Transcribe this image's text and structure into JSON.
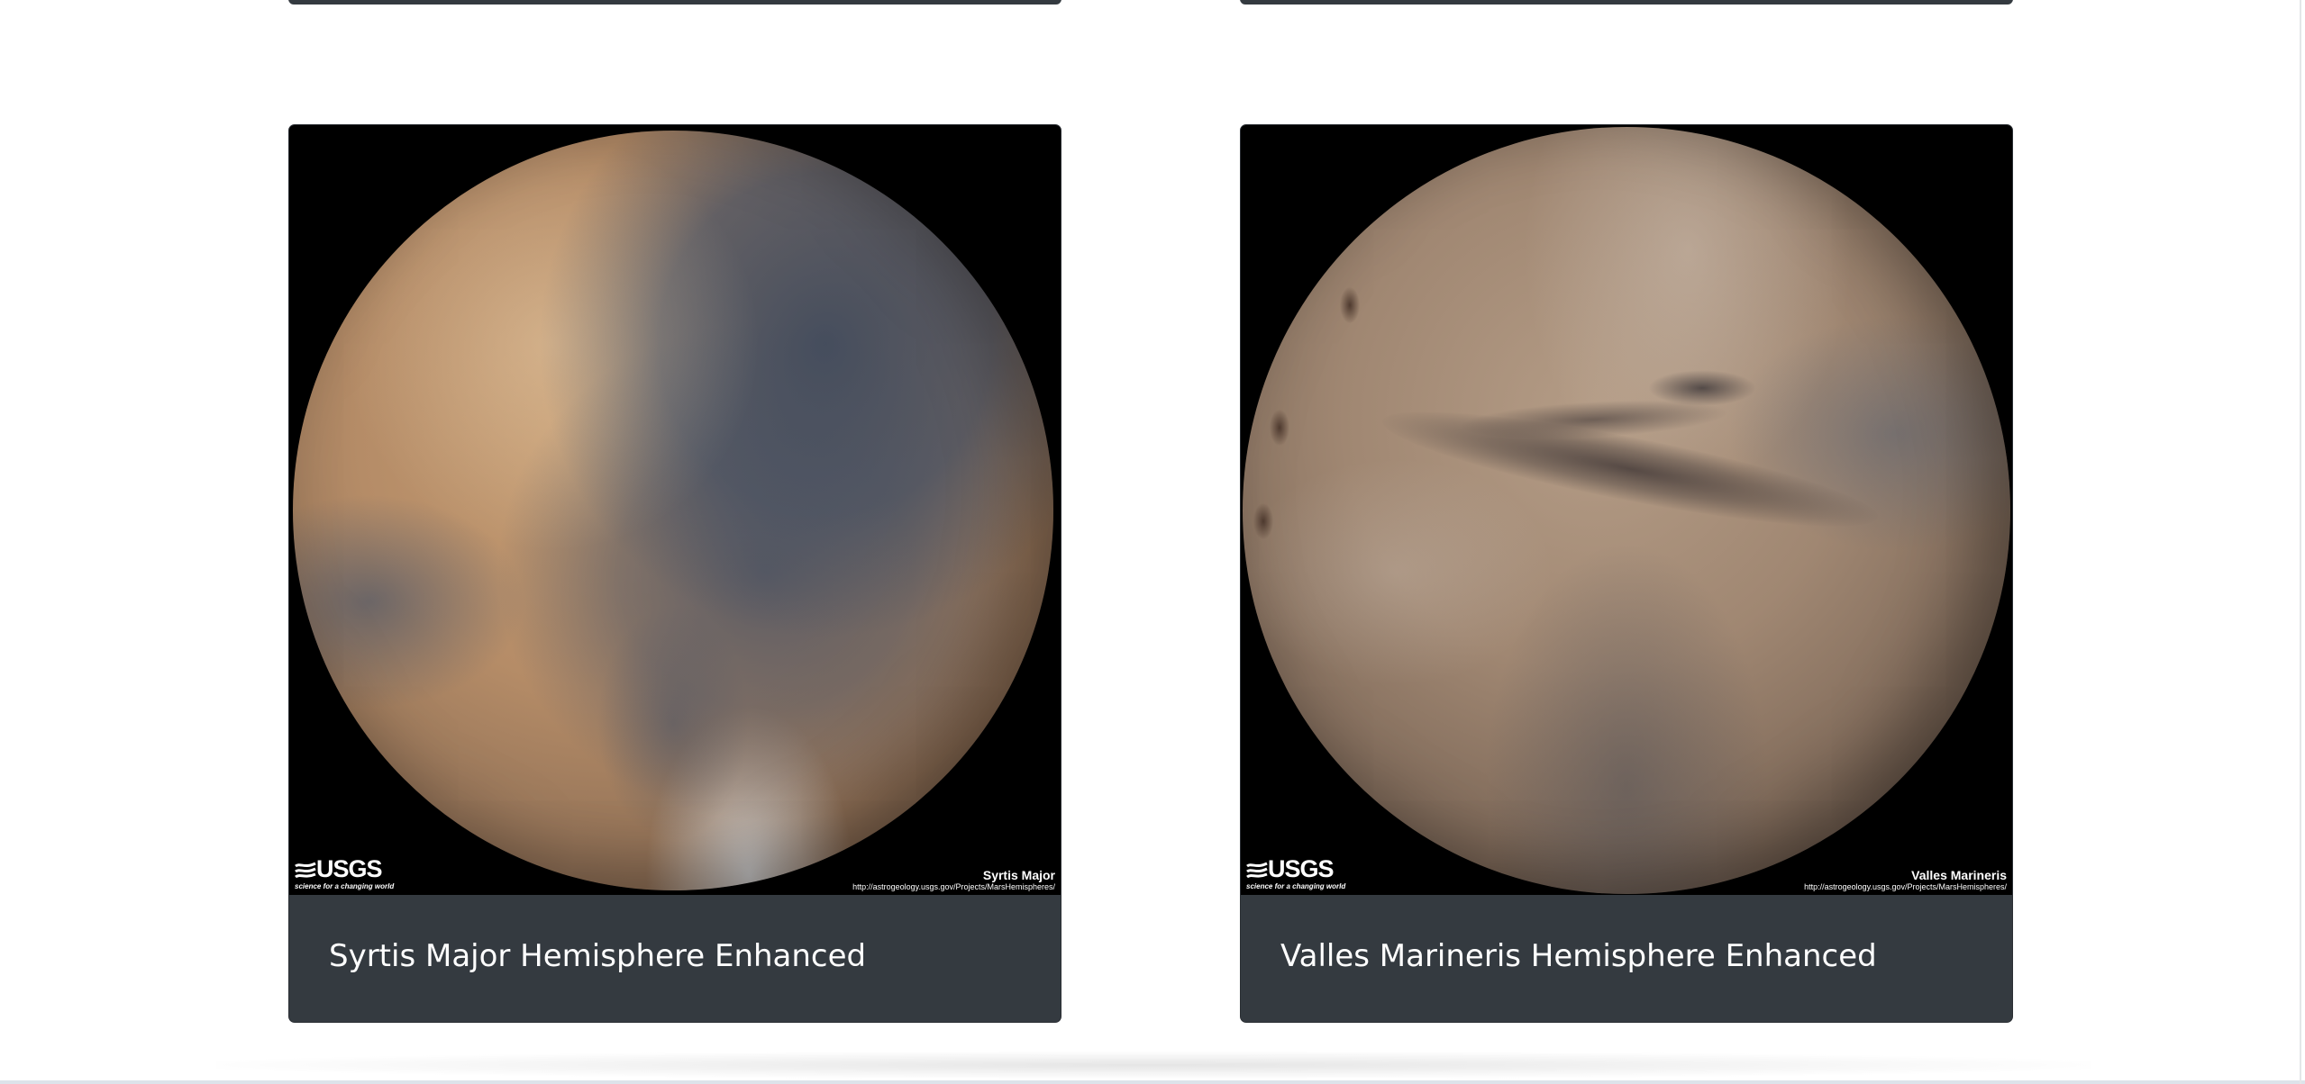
{
  "cards": [
    {
      "title": "Syrtis Major Hemisphere Enhanced",
      "image": {
        "caption_name": "Syrtis Major",
        "caption_url": "http://astrogeology.usgs.gov/Projects/MarsHemispheres/",
        "logo_text": "USGS",
        "logo_tagline": "science for a changing world"
      }
    },
    {
      "title": "Valles Marineris Hemisphere Enhanced",
      "image": {
        "caption_name": "Valles Marineris",
        "caption_url": "http://astrogeology.usgs.gov/Projects/MarsHemispheres/",
        "logo_text": "USGS",
        "logo_tagline": "science for a changing world"
      }
    }
  ],
  "colors": {
    "card_background": "#343a40",
    "image_background": "#000000",
    "page_background": "#ffffff",
    "title_text": "#ffffff"
  },
  "icons": [
    "usgs-logo-icon"
  ]
}
